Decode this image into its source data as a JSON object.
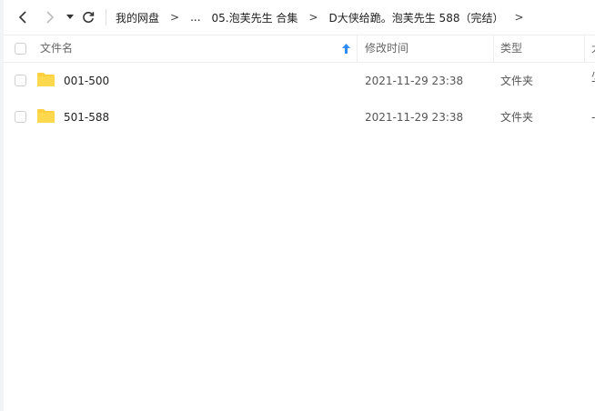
{
  "toolbar": {
    "breadcrumbs": [
      "我的网盘",
      "...",
      "05.泡芙先生 合集",
      "D大侠给跪。泡芙先生  588（完结）"
    ],
    "separator": ">"
  },
  "header": {
    "name": "文件名",
    "mtime": "修改时间",
    "type": "类型",
    "size": "大小"
  },
  "rows": [
    {
      "name": "001-500",
      "mtime": "2021-11-29 23:38",
      "type": "文件夹",
      "size": "-"
    },
    {
      "name": "501-588",
      "mtime": "2021-11-29 23:38",
      "type": "文件夹",
      "size": "-"
    }
  ],
  "colors": {
    "folder": "#ffcf3f",
    "sort_arrow": "#2f8cf4",
    "border": "#eeeeee"
  }
}
